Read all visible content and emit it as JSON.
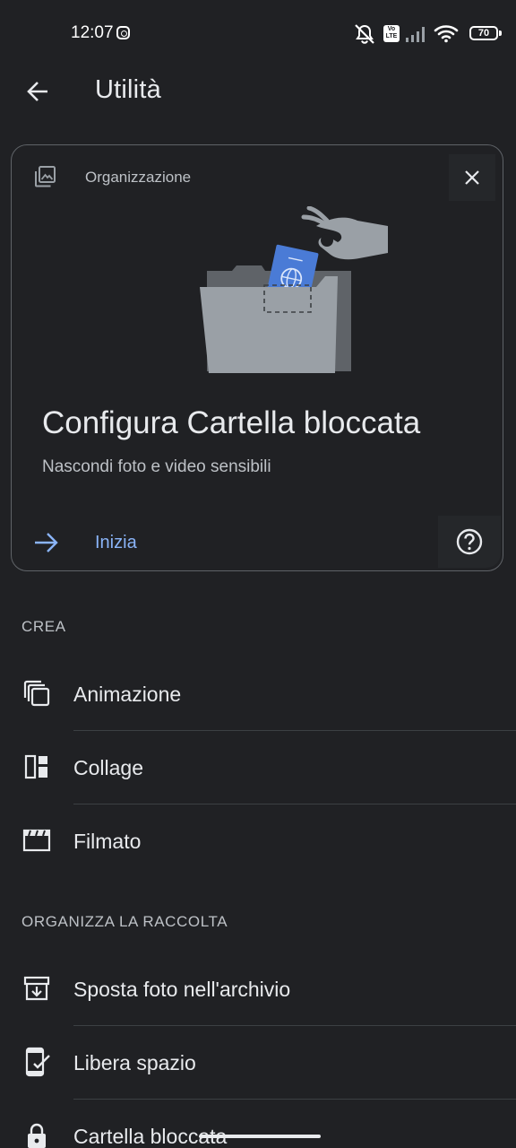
{
  "status_bar": {
    "time": "12:07",
    "network_badge": "Vo LTE",
    "battery_level": "70",
    "icons": [
      "instagram-icon",
      "mute-icon",
      "volte-icon",
      "signal-icon",
      "wifi-icon",
      "battery-icon"
    ]
  },
  "app_bar": {
    "title": "Utilità",
    "back_icon": "arrow-left-icon"
  },
  "card": {
    "category": "Organizzazione",
    "category_icon": "photo-library-icon",
    "close_icon": "close-icon",
    "title": "Configura Cartella bloccata",
    "subtitle": "Nascondi foto e video sensibili",
    "start_label": "Inizia",
    "start_icon": "arrow-right-icon",
    "help_icon": "help-circle-icon",
    "accent_color": "#8ab4f8",
    "illustration": "locked-folder-illustration"
  },
  "sections": [
    {
      "header": "CREA",
      "items": [
        {
          "label": "Animazione",
          "icon": "animation-icon"
        },
        {
          "label": "Collage",
          "icon": "collage-icon"
        },
        {
          "label": "Filmato",
          "icon": "movie-icon"
        }
      ]
    },
    {
      "header": "ORGANIZZA LA RACCOLTA",
      "items": [
        {
          "label": "Sposta foto nell'archivio",
          "icon": "archive-icon"
        },
        {
          "label": "Libera spazio",
          "icon": "free-space-icon"
        },
        {
          "label": "Cartella bloccata",
          "icon": "lock-icon"
        }
      ]
    }
  ],
  "colors": {
    "background": "#202124",
    "text": "#e8eaed",
    "secondary_text": "#bdc1c6",
    "accent": "#8ab4f8"
  }
}
